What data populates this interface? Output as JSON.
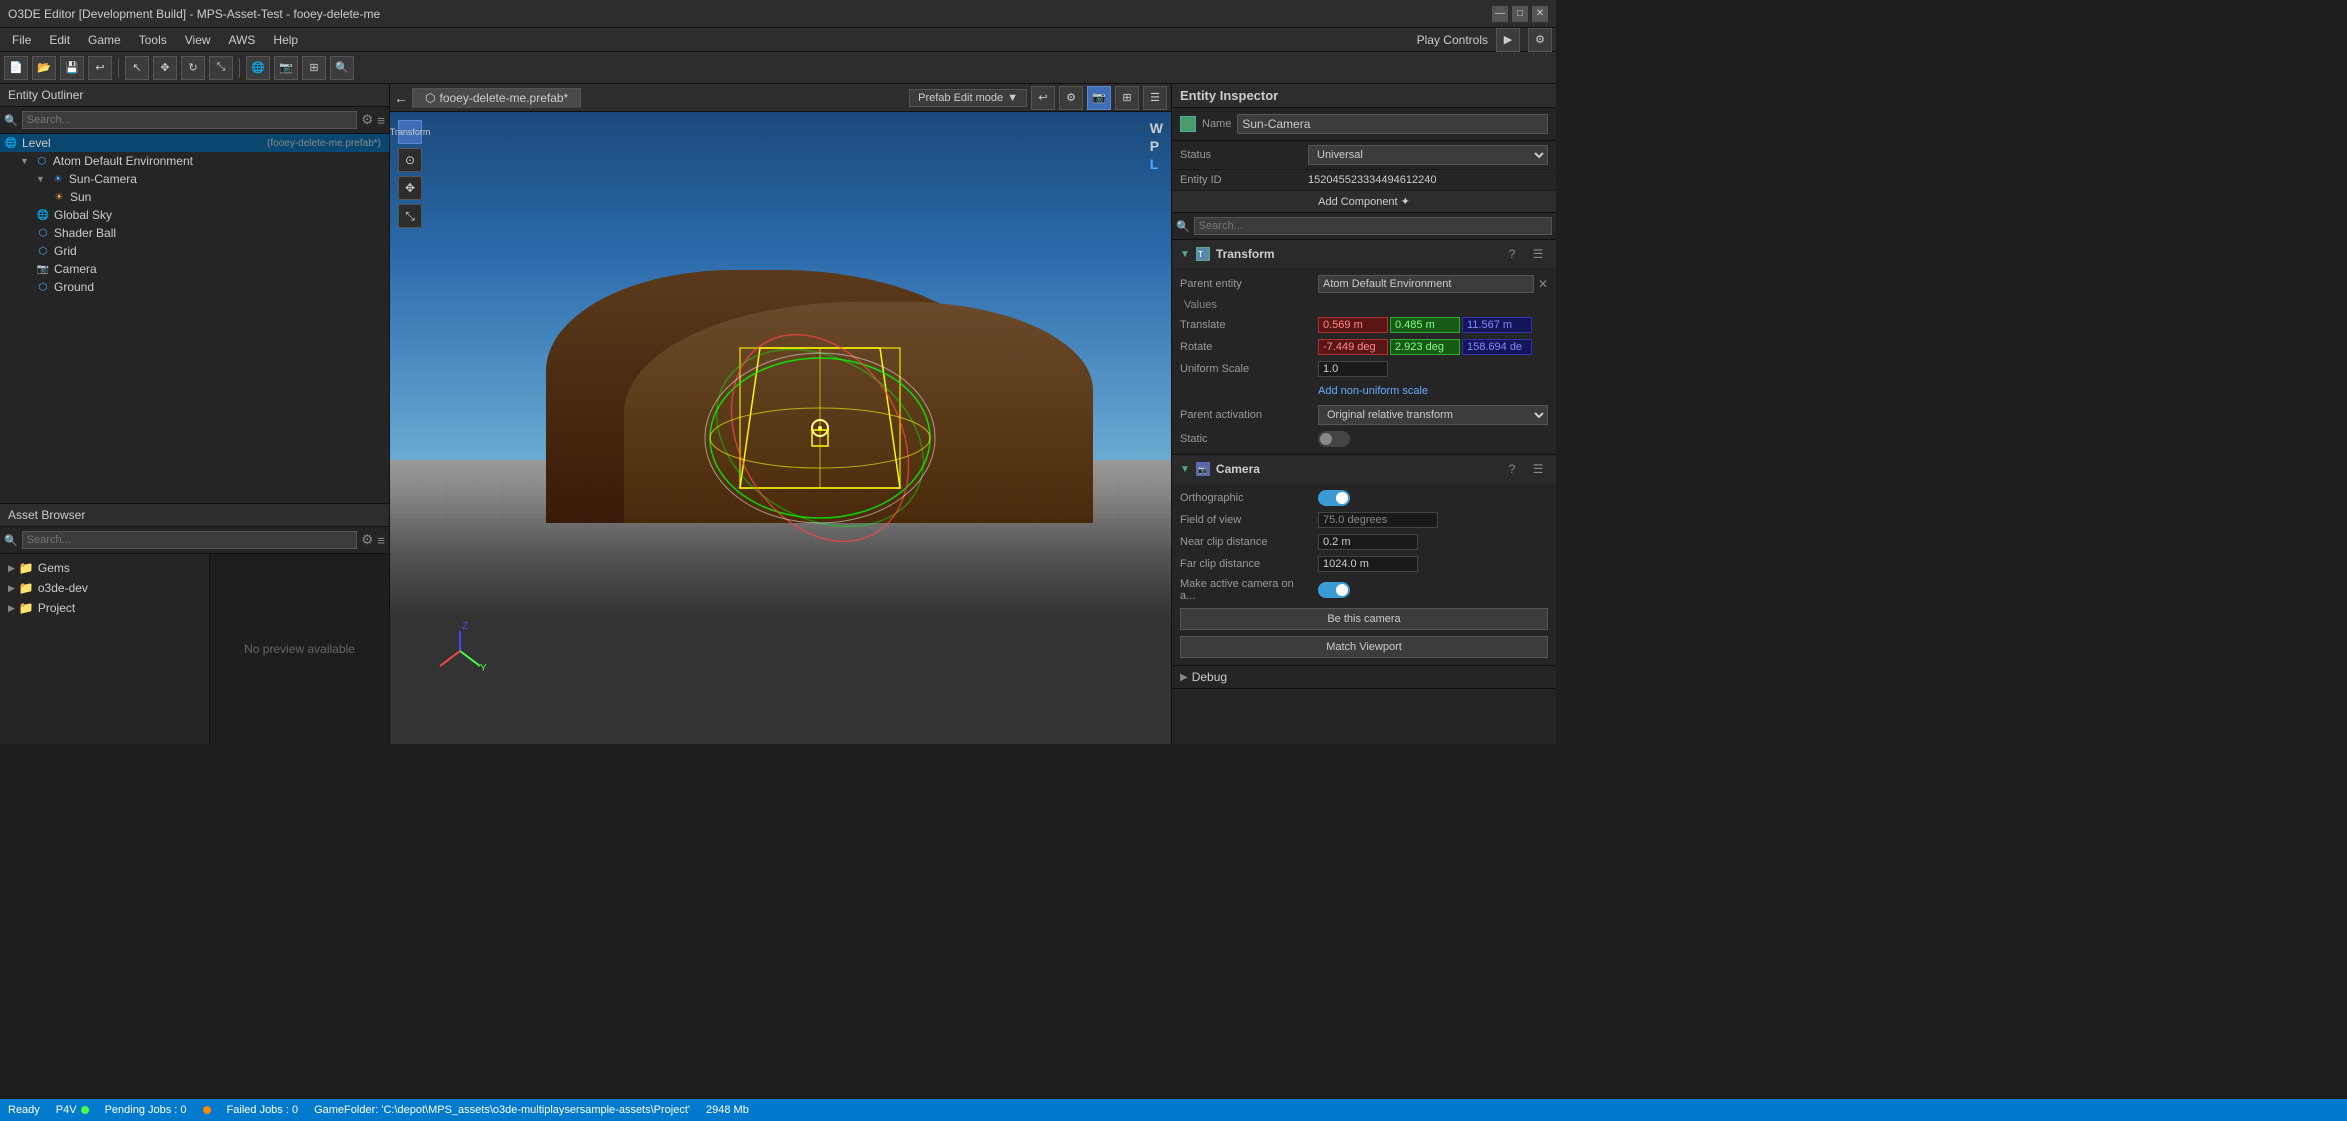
{
  "titlebar": {
    "title": "O3DE Editor [Development Build] - MPS-Asset-Test - fooey-delete-me",
    "minimize": "—",
    "maximize": "□",
    "close": "✕"
  },
  "menubar": {
    "items": [
      "File",
      "Edit",
      "Game",
      "Tools",
      "View",
      "AWS",
      "Help"
    ]
  },
  "toolbar": {
    "play_label": "Play Controls",
    "play_icon": "▶"
  },
  "entity_outliner": {
    "header": "Entity Outliner",
    "search_placeholder": "Search...",
    "items": [
      {
        "indent": 0,
        "icon": "🌐",
        "label": "Level",
        "tag": "(fooey-delete-me.prefab*)",
        "selected": true
      },
      {
        "indent": 1,
        "icon": "⬡",
        "label": "Atom Default Environment",
        "tag": ""
      },
      {
        "indent": 2,
        "icon": "☀",
        "label": "Sun-Camera",
        "tag": ""
      },
      {
        "indent": 3,
        "icon": "☀",
        "label": "Sun",
        "tag": ""
      },
      {
        "indent": 2,
        "icon": "🌐",
        "label": "Global Sky",
        "tag": ""
      },
      {
        "indent": 2,
        "icon": "⬡",
        "label": "Shader Ball",
        "tag": ""
      },
      {
        "indent": 2,
        "icon": "⬡",
        "label": "Grid",
        "tag": ""
      },
      {
        "indent": 2,
        "icon": "📷",
        "label": "Camera",
        "tag": ""
      },
      {
        "indent": 2,
        "icon": "⬡",
        "label": "Ground",
        "tag": ""
      }
    ]
  },
  "asset_browser": {
    "header": "Asset Browser",
    "search_placeholder": "Search...",
    "no_preview": "No preview available",
    "tree_items": [
      {
        "icon": "📁",
        "label": "Gems"
      },
      {
        "icon": "📁",
        "label": "o3de-dev"
      },
      {
        "icon": "📁",
        "label": "Project"
      }
    ]
  },
  "viewport": {
    "tab_label": "fooey-delete-me.prefab*",
    "tab_icon": "⬡",
    "mode_btn": "Prefab Edit mode",
    "transform_label": "Transform",
    "wpl_w": "W",
    "wpl_p": "P",
    "wpl_l": "L"
  },
  "inspector": {
    "header": "Entity Inspector",
    "name_label": "Name",
    "name_value": "Sun-Camera",
    "status_label": "Status",
    "status_value": "Universal",
    "entity_id_label": "Entity ID",
    "entity_id_value": "152045523334494612240",
    "add_component_label": "Add Component ✦",
    "search_placeholder": "Search...",
    "transform": {
      "title": "Transform",
      "parent_entity_label": "Parent entity",
      "parent_entity_value": "Atom Default Environment",
      "values_label": "Values",
      "translate_label": "Translate",
      "translate_x": "0.569 m",
      "translate_y": "0.485 m",
      "translate_z": "11.567 m",
      "rotate_label": "Rotate",
      "rotate_x": "-7.449 deg",
      "rotate_y": "2.923 deg",
      "rotate_z": "158.694 de",
      "uniform_scale_label": "Uniform Scale",
      "uniform_scale_value": "1.0",
      "add_nonuniform_label": "Add non-uniform scale",
      "parent_activation_label": "Parent activation",
      "parent_activation_value": "Original relative transform",
      "static_label": "Static"
    },
    "camera": {
      "title": "Camera",
      "orthographic_label": "Orthographic",
      "fov_label": "Field of view",
      "fov_value": "75.0 degrees",
      "near_clip_label": "Near clip distance",
      "near_clip_value": "0.2 m",
      "far_clip_label": "Far clip distance",
      "far_clip_value": "1024.0 m",
      "make_active_label": "Make active camera on a...",
      "be_camera_btn": "Be this camera",
      "match_viewport_btn": "Match Viewport"
    },
    "debug": {
      "title": "Debug"
    }
  },
  "statusbar": {
    "p4v": "P4V",
    "pending_jobs": "Pending Jobs : 0",
    "failed_jobs": "Failed Jobs : 0",
    "game_folder": "GameFolder: 'C:\\depot\\MPS_assets\\o3de-multiplaysersample-assets\\Project'",
    "size": "2948 Mb",
    "ready": "Ready"
  }
}
